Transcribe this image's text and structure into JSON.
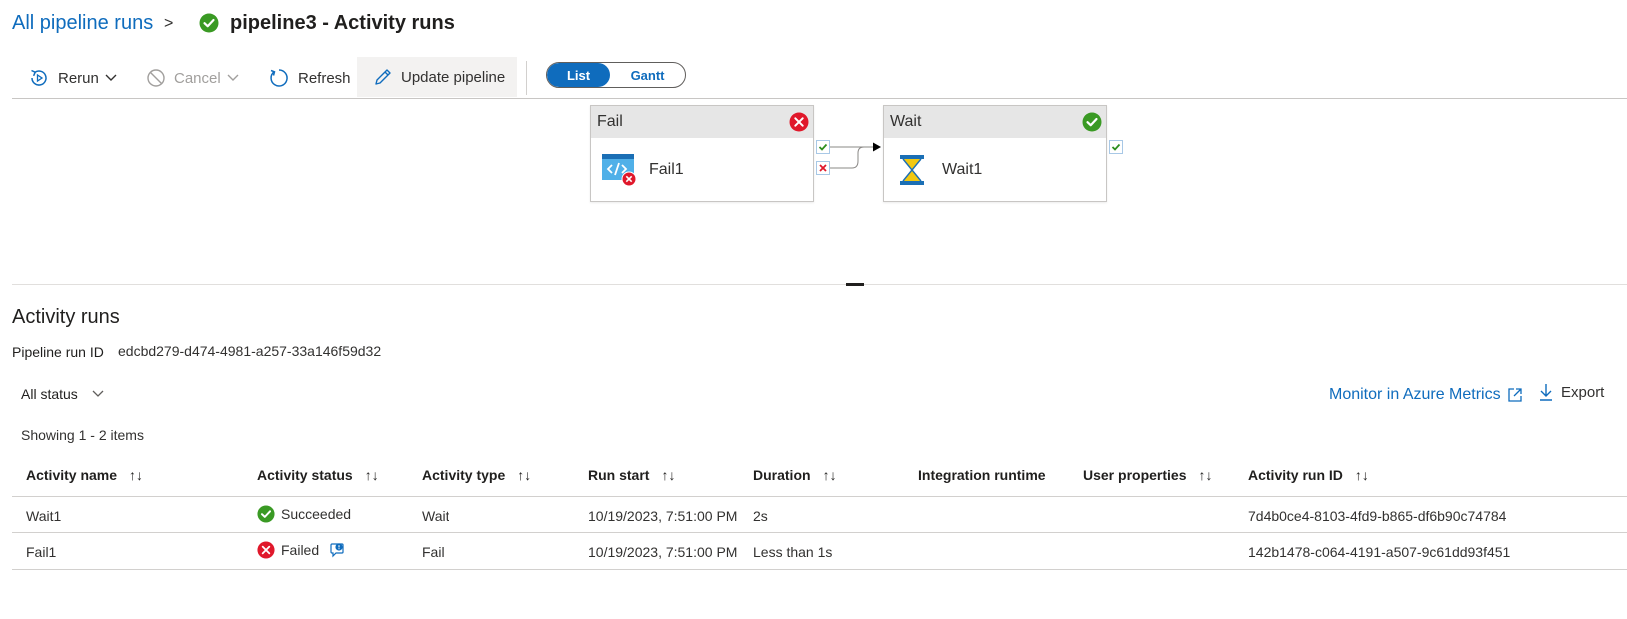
{
  "breadcrumb": {
    "root": "All pipeline runs",
    "separator": ">",
    "title": "pipeline3 - Activity runs"
  },
  "toolbar": {
    "rerun": "Rerun",
    "cancel": "Cancel",
    "refresh": "Refresh",
    "update_pipeline": "Update pipeline",
    "view_toggle": {
      "list": "List",
      "gantt": "Gantt",
      "selected": "List"
    }
  },
  "canvas": {
    "activities": [
      {
        "type": "Fail",
        "name": "Fail1",
        "status": "failed"
      },
      {
        "type": "Wait",
        "name": "Wait1",
        "status": "succeeded"
      }
    ]
  },
  "activity_runs": {
    "title": "Activity runs",
    "pipeline_run_id_label": "Pipeline run ID",
    "pipeline_run_id": "edcbd279-d474-4981-a257-33a146f59d32",
    "status_filter": "All status",
    "monitor_link": "Monitor in Azure Metrics",
    "export_label": "Export",
    "showing": "Showing 1 - 2 items",
    "columns": [
      "Activity name",
      "Activity status",
      "Activity type",
      "Run start",
      "Duration",
      "Integration runtime",
      "User properties",
      "Activity run ID"
    ],
    "rows": [
      {
        "name": "Wait1",
        "status": "Succeeded",
        "type": "Wait",
        "run_start": "10/19/2023, 7:51:00 PM",
        "duration": "2s",
        "runtime": "",
        "user_properties": "",
        "run_id": "7d4b0ce4-8103-4fd9-b865-df6b90c74784"
      },
      {
        "name": "Fail1",
        "status": "Failed",
        "type": "Fail",
        "run_start": "10/19/2023, 7:51:00 PM",
        "duration": "Less than 1s",
        "runtime": "",
        "user_properties": "",
        "run_id": "142b1478-c064-4191-a507-9c61dd93f451"
      }
    ]
  },
  "colors": {
    "accent": "#0f6cbd",
    "success": "#2d8f1e",
    "error": "#e0182b"
  }
}
